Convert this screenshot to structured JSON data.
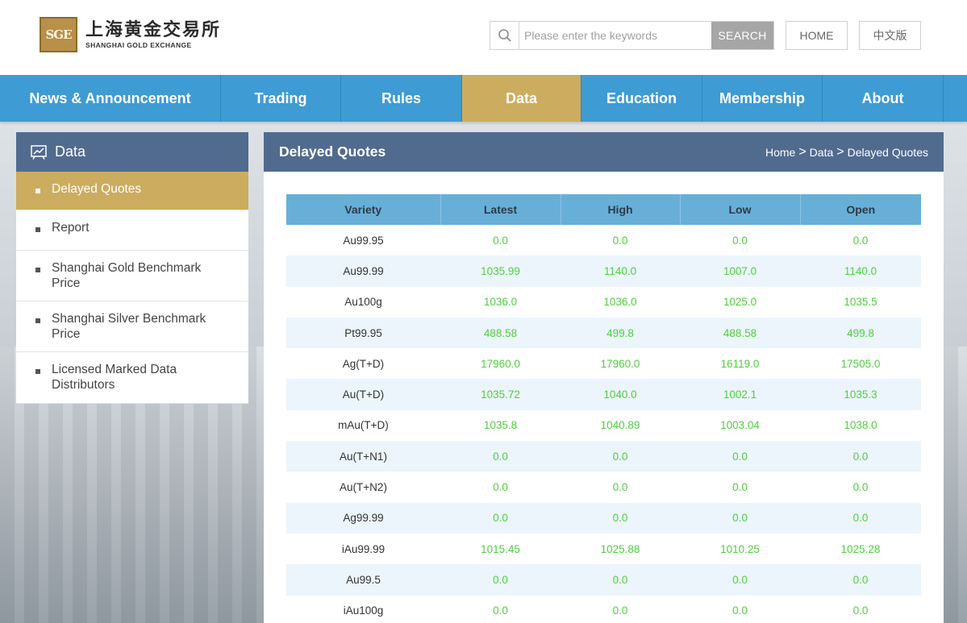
{
  "header": {
    "logo_mark": "SGE",
    "logo_cn": "上海黄金交易所",
    "logo_en": "SHANGHAI GOLD EXCHANGE",
    "search_placeholder": "Please enter the keywords",
    "search_label": "SEARCH",
    "home_label": "HOME",
    "lang_label": "中文版"
  },
  "nav": [
    {
      "label": "News & Announcement",
      "active": false
    },
    {
      "label": "Trading",
      "active": false
    },
    {
      "label": "Rules",
      "active": false
    },
    {
      "label": "Data",
      "active": true
    },
    {
      "label": "Education",
      "active": false
    },
    {
      "label": "Membership",
      "active": false
    },
    {
      "label": "About",
      "active": false
    }
  ],
  "sidebar": {
    "title": "Data",
    "items": [
      {
        "label": "Delayed Quotes",
        "active": true
      },
      {
        "label": "Report",
        "active": false
      },
      {
        "label": "Shanghai Gold Benchmark Price",
        "active": false
      },
      {
        "label": "Shanghai Silver Benchmark Price",
        "active": false
      },
      {
        "label": "Licensed Marked Data Distributors",
        "active": false
      }
    ]
  },
  "main": {
    "title": "Delayed Quotes",
    "breadcrumb": [
      "Home",
      "Data",
      "Delayed Quotes"
    ],
    "breadcrumb_sep": ">"
  },
  "table": {
    "columns": [
      "Variety",
      "Latest",
      "High",
      "Low",
      "Open"
    ],
    "rows": [
      [
        "Au99.95",
        "0.0",
        "0.0",
        "0.0",
        "0.0"
      ],
      [
        "Au99.99",
        "1035.99",
        "1140.0",
        "1007.0",
        "1140.0"
      ],
      [
        "Au100g",
        "1036.0",
        "1036.0",
        "1025.0",
        "1035.5"
      ],
      [
        "Pt99.95",
        "488.58",
        "499.8",
        "488.58",
        "499.8"
      ],
      [
        "Ag(T+D)",
        "17960.0",
        "17960.0",
        "16119.0",
        "17505.0"
      ],
      [
        "Au(T+D)",
        "1035.72",
        "1040.0",
        "1002.1",
        "1035.3"
      ],
      [
        "mAu(T+D)",
        "1035.8",
        "1040.89",
        "1003.04",
        "1038.0"
      ],
      [
        "Au(T+N1)",
        "0.0",
        "0.0",
        "0.0",
        "0.0"
      ],
      [
        "Au(T+N2)",
        "0.0",
        "0.0",
        "0.0",
        "0.0"
      ],
      [
        "Ag99.99",
        "0.0",
        "0.0",
        "0.0",
        "0.0"
      ],
      [
        "iAu99.99",
        "1015.45",
        "1025.88",
        "1010.25",
        "1025.28"
      ],
      [
        "Au99.5",
        "0.0",
        "0.0",
        "0.0",
        "0.0"
      ],
      [
        "iAu100g",
        "0.0",
        "0.0",
        "0.0",
        "0.0"
      ]
    ]
  },
  "colors": {
    "nav_blue": "#3f9bd3",
    "accent_gold": "#ccac5e",
    "panel_slate": "#516b8f",
    "table_header": "#68afd8",
    "value_green": "#4fcf3e"
  }
}
